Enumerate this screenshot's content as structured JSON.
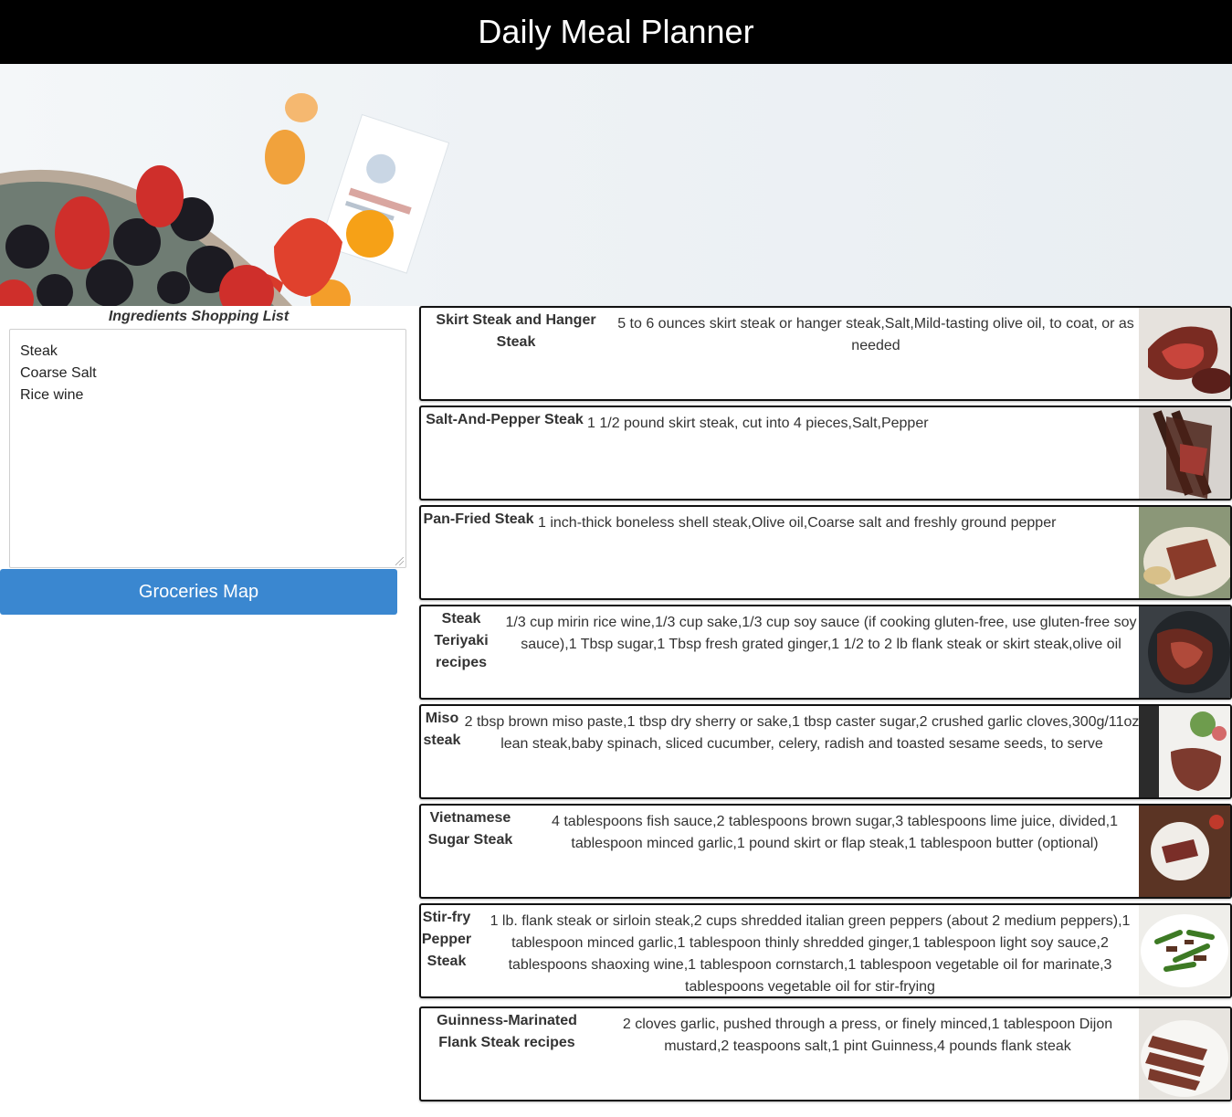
{
  "header": {
    "title": "Daily Meal Planner"
  },
  "shopping_list": {
    "title": "Ingredients Shopping List",
    "items": [
      "Steak",
      "Coarse Salt",
      "Rice wine"
    ]
  },
  "groceries_button": {
    "label": "Groceries Map"
  },
  "recipes": [
    {
      "name": "Skirt Steak and Hanger Steak",
      "ingredients": "5 to 6 ounces skirt steak or hanger steak,Salt,Mild-tasting olive oil, to coat, or as needed",
      "thumb_icon": "steak-photo"
    },
    {
      "name": "Salt-And-Pepper Steak",
      "ingredients": "1 1/2 pound skirt steak, cut into 4 pieces,Salt,Pepper",
      "thumb_icon": "steak-photo"
    },
    {
      "name": "Pan-Fried Steak",
      "ingredients": "1 inch-thick boneless shell steak,Olive oil,Coarse salt and freshly ground pepper",
      "thumb_icon": "steak-photo"
    },
    {
      "name": "Steak Teriyaki recipes",
      "ingredients": "1/3 cup mirin rice wine,1/3 cup sake,1/3 cup soy sauce (if cooking gluten-free, use gluten-free soy sauce),1 Tbsp sugar,1 Tbsp fresh grated ginger,1 1/2 to 2 lb flank steak or skirt steak,olive oil",
      "thumb_icon": "steak-photo"
    },
    {
      "name": "Miso steak",
      "ingredients": "2 tbsp brown miso paste,1 tbsp dry sherry or sake,1 tbsp caster sugar,2 crushed garlic cloves,300g/11oz lean steak,baby spinach, sliced cucumber, celery, radish and toasted sesame seeds, to serve",
      "thumb_icon": "steak-photo"
    },
    {
      "name": "Vietnamese Sugar Steak",
      "ingredients": "4 tablespoons fish sauce,2 tablespoons brown sugar,3 tablespoons lime juice, divided,1 tablespoon minced garlic,1 pound skirt or flap steak,1 tablespoon butter (optional)",
      "thumb_icon": "steak-photo"
    },
    {
      "name": "Stir-fry Pepper Steak",
      "ingredients": "1 lb. flank steak or sirloin steak,2 cups shredded italian green peppers (about 2 medium peppers),1 tablespoon minced garlic,1 tablespoon thinly shredded ginger,1 tablespoon light soy sauce,2 tablespoons shaoxing wine,1 tablespoon cornstarch,1 tablespoon vegetable oil for marinate,3 tablespoons vegetable oil for stir-frying",
      "thumb_icon": "pepper-steak-photo"
    },
    {
      "name": "Guinness-Marinated Flank Steak recipes",
      "ingredients": "2 cloves garlic, pushed through a press, or finely minced,1 tablespoon Dijon mustard,2 teaspoons salt,1 pint Guinness,4 pounds flank steak",
      "thumb_icon": "steak-photo"
    }
  ]
}
